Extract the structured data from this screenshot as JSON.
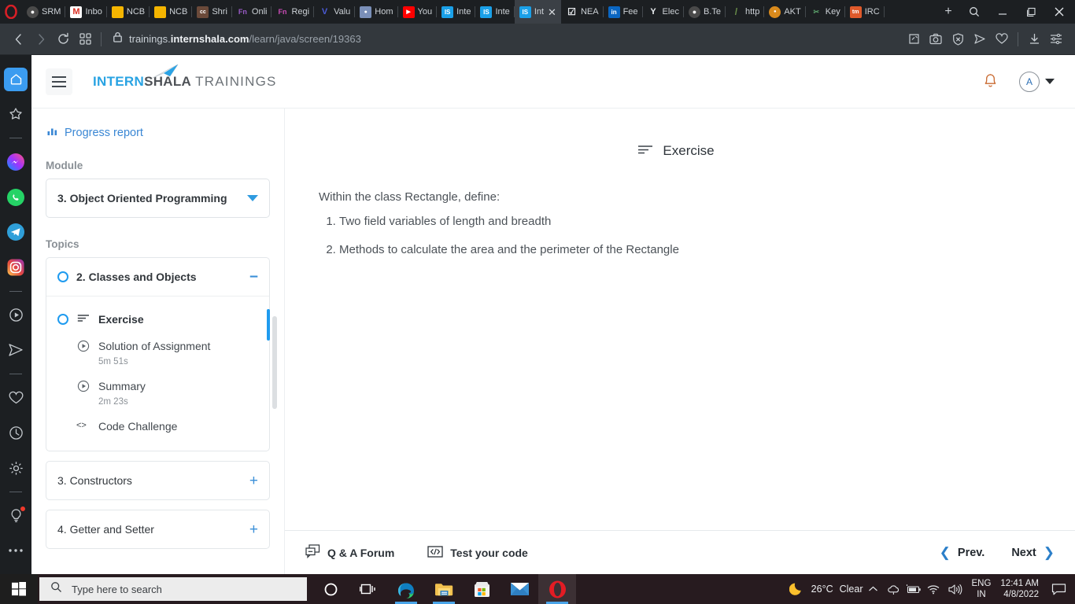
{
  "browser": {
    "name": "Opera",
    "tabs": [
      {
        "label": "SRM",
        "icon": "globe-icon",
        "color": "#4a4a4a",
        "active": false
      },
      {
        "label": "Inbo",
        "icon": "gmail-icon",
        "color": "#ffffff",
        "active": false
      },
      {
        "label": "NCB",
        "icon": "folder-yellow-icon",
        "color": "#f5b500",
        "active": false
      },
      {
        "label": "NCB",
        "icon": "folder-yellow-icon",
        "color": "#f5b500",
        "active": false
      },
      {
        "label": "Shri",
        "icon": "cc-icon",
        "color": "#6b4a3a",
        "active": false
      },
      {
        "label": "Onli",
        "icon": "fn-icon",
        "color": "#9b5bc8",
        "active": false
      },
      {
        "label": "Regi",
        "icon": "fn-icon",
        "color": "#c84bb5",
        "active": false
      },
      {
        "label": "Valu",
        "icon": "v-icon",
        "color": "#4b5bd6",
        "active": false
      },
      {
        "label": "Hom",
        "icon": "character-icon",
        "color": "#7a8fb8",
        "active": false
      },
      {
        "label": "You",
        "icon": "youtube-icon",
        "color": "#ff0000",
        "active": false
      },
      {
        "label": "Inte",
        "icon": "is-icon",
        "color": "#1aa0e8",
        "active": false
      },
      {
        "label": "Inte",
        "icon": "is-icon",
        "color": "#1aa0e8",
        "active": false
      },
      {
        "label": "Int",
        "icon": "is-icon",
        "color": "#1aa0e8",
        "active": true
      },
      {
        "label": "NEA",
        "icon": "checkbox-link-icon",
        "color": "#ffffff",
        "active": false
      },
      {
        "label": "Fee",
        "icon": "linkedin-icon",
        "color": "#0a66c2",
        "active": false
      },
      {
        "label": "Elec",
        "icon": "y-icon",
        "color": "#ffffff",
        "active": false
      },
      {
        "label": "B.Te",
        "icon": "globe-icon",
        "color": "#4a4a4a",
        "active": false
      },
      {
        "label": "http",
        "icon": "slash-icon",
        "color": "#6a8f4a",
        "active": false
      },
      {
        "label": "AKT",
        "icon": "seal-icon",
        "color": "#d98a1c",
        "active": false
      },
      {
        "label": "Key",
        "icon": "scissors-icon",
        "color": "#5aa06a",
        "active": false
      },
      {
        "label": "IRC",
        "icon": "tm-icon",
        "color": "#e05a2b",
        "active": false
      }
    ],
    "new_tab_label": "+",
    "window_controls": {
      "search": "search-icon",
      "minimize": "minimize-icon",
      "maximize": "maximize-icon",
      "close": "close-icon"
    },
    "nav": {
      "back": "back-icon",
      "forward": "forward-icon",
      "reload": "reload-icon",
      "tab_grid": "tab-grid-icon",
      "lock": "lock-icon"
    },
    "url": {
      "subdomain": "trainings.",
      "domain": "internshala.com",
      "path": "/learn/java/screen/19363",
      "full": "trainings.internshala.com/learn/java/screen/19363"
    },
    "nav_right_icons": [
      "pin-icon",
      "snapshot-icon",
      "shield-blocked-icon",
      "send-icon",
      "heart-icon",
      "download-icon",
      "easy-setup-icon"
    ],
    "sidebar_icons": [
      {
        "name": "home-icon",
        "selected": true
      },
      {
        "name": "bookmarks-star-icon",
        "selected": false
      },
      {
        "name": "divider",
        "selected": false
      },
      {
        "name": "messenger-icon",
        "selected": false
      },
      {
        "name": "whatsapp-icon",
        "selected": false
      },
      {
        "name": "telegram-icon",
        "selected": false
      },
      {
        "name": "instagram-icon",
        "selected": false
      },
      {
        "name": "divider",
        "selected": false
      },
      {
        "name": "player-icon",
        "selected": false
      },
      {
        "name": "send-messages-icon",
        "selected": false
      },
      {
        "name": "divider",
        "selected": false
      },
      {
        "name": "heart-icon",
        "selected": false
      },
      {
        "name": "history-clock-icon",
        "selected": false
      },
      {
        "name": "settings-gear-icon",
        "selected": false
      },
      {
        "name": "divider",
        "selected": false
      },
      {
        "name": "tips-bulb-icon",
        "selected": false,
        "badge": true
      },
      {
        "name": "more-dots-icon",
        "selected": false
      }
    ]
  },
  "site_header": {
    "menu_icon": "hamburger-icon",
    "logo": {
      "part1": "INTERN",
      "part2": "SHALA",
      "part3": "TRAININGS",
      "plane": "paper-plane-icon"
    },
    "notification_icon": "bell-icon",
    "avatar_initial": "A",
    "accent_blue": "#29a3e3"
  },
  "sidebar": {
    "progress_report": "Progress report",
    "progress_icon": "bar-chart-icon",
    "module_label": "Module",
    "module_value": "3. Object Oriented Programming",
    "topics_label": "Topics",
    "topics": [
      {
        "title": "2. Classes and Objects",
        "expanded": true,
        "toggle": "−",
        "items": [
          {
            "title": "Exercise",
            "icon": "exercise-lines-icon",
            "duration": "",
            "active": true,
            "has_ring": true
          },
          {
            "title": "Solution of Assignment",
            "icon": "play-circle-icon",
            "duration": "5m 51s",
            "active": false,
            "has_ring": false
          },
          {
            "title": "Summary",
            "icon": "play-circle-icon",
            "duration": "2m 23s",
            "active": false,
            "has_ring": false
          },
          {
            "title": "Code Challenge",
            "icon": "code-brackets-icon",
            "duration": "",
            "active": false,
            "has_ring": false
          }
        ]
      },
      {
        "title": "3. Constructors",
        "expanded": false,
        "toggle": "+",
        "items": []
      },
      {
        "title": "4. Getter and Setter",
        "expanded": false,
        "toggle": "+",
        "items": []
      }
    ]
  },
  "main": {
    "title": "Exercise",
    "title_icon": "exercise-lines-icon",
    "intro": "Within the class Rectangle, define:",
    "steps": [
      "Two field variables of length and breadth",
      "Methods to calculate the area and the perimeter of the Rectangle"
    ]
  },
  "footer": {
    "qa_forum": "Q & A Forum",
    "qa_icon": "chat-windows-icon",
    "test_code": "Test your code",
    "test_icon": "code-box-icon",
    "prev": "Prev.",
    "next": "Next",
    "prev_icon": "chevron-left-icon",
    "next_icon": "chevron-right-icon"
  },
  "taskbar": {
    "start_icon": "windows-start-icon",
    "search_placeholder": "Type here to search",
    "search_icon": "search-icon",
    "apps": [
      {
        "name": "cortana-icon",
        "running": false,
        "active": false
      },
      {
        "name": "task-view-icon",
        "running": false,
        "active": false
      },
      {
        "name": "edge-icon",
        "running": true,
        "active": false
      },
      {
        "name": "file-explorer-icon",
        "running": true,
        "active": false
      },
      {
        "name": "microsoft-store-icon",
        "running": false,
        "active": false
      },
      {
        "name": "mail-icon",
        "running": false,
        "active": false
      },
      {
        "name": "opera-icon",
        "running": true,
        "active": true
      }
    ],
    "weather_icon": "moon-icon",
    "temperature": "26°C",
    "condition": "Clear",
    "tray_icons": [
      "chevron-up-icon",
      "onedrive-icon",
      "battery-icon",
      "wifi-icon",
      "volume-icon"
    ],
    "language_line1": "ENG",
    "language_line2": "IN",
    "time": "12:41 AM",
    "date": "4/8/2022",
    "notification_icon": "action-center-icon"
  }
}
